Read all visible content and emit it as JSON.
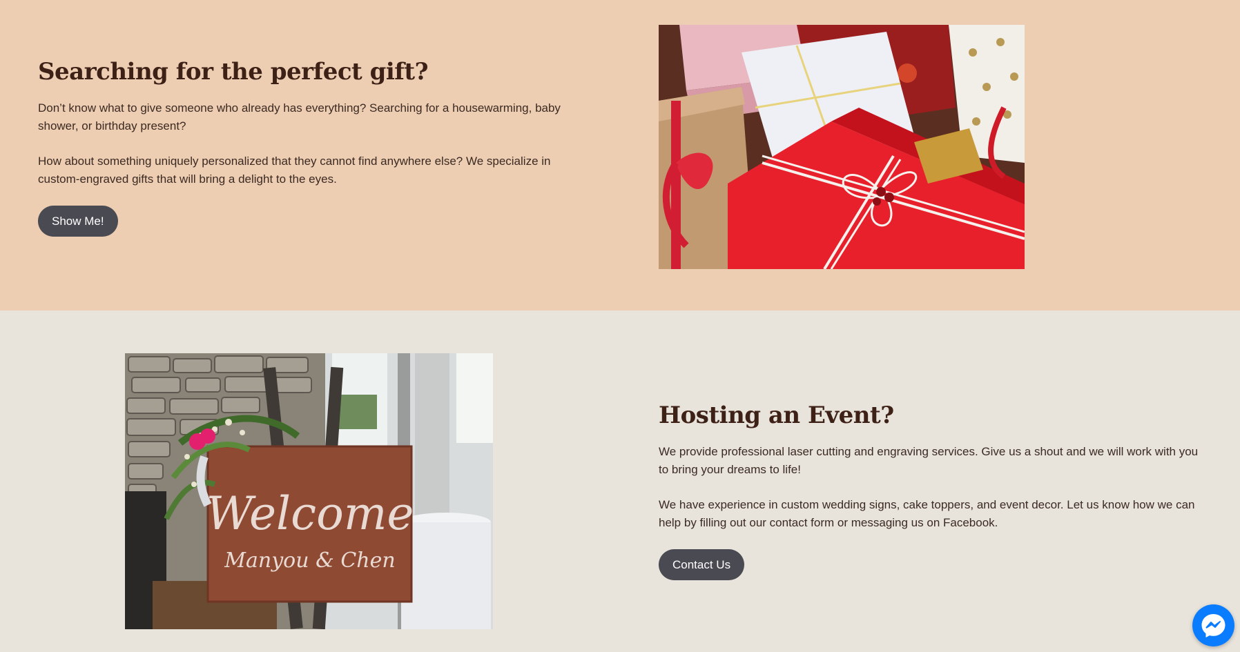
{
  "gift_section": {
    "heading": "Searching for the perfect gift?",
    "paragraph1": "Don’t know what to give someone who already has everything? Searching for a housewarming, baby shower, or birthday present?",
    "paragraph2": "How about something uniquely personalized that they cannot find anywhere else? We specialize in custom-engraved gifts that will bring a delight to the eyes.",
    "button_label": "Show Me!",
    "background_color": "#eeceb3"
  },
  "event_section": {
    "heading": "Hosting an Event?",
    "paragraph1": "We provide professional laser cutting and engraving services. Give us a shout and we will work with you to bring your dreams to life!",
    "paragraph2": "We have experience in custom wedding signs, cake toppers, and event decor. Let us know how we can help by filling out our contact form or messaging us on Facebook.",
    "button_label": "Contact Us",
    "background_color": "#e8e4dc",
    "sign_text_line1": "Welcome",
    "sign_text_line2": "Manyou & Chen"
  },
  "button_color": "#4a4a52",
  "messenger": {
    "icon": "messenger-icon",
    "color": "#0a7cff"
  }
}
